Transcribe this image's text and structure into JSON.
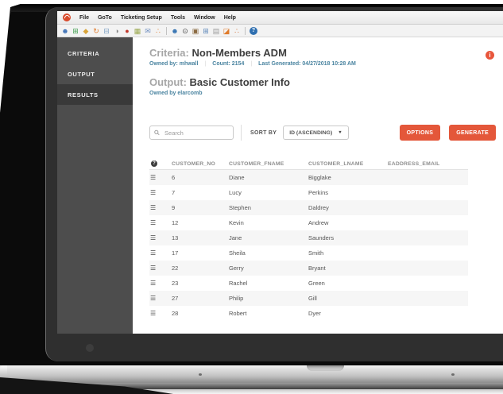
{
  "colors": {
    "accent": "#e4573a",
    "meta_text": "#4a84a0",
    "sidebar_bg": "#4d4d4d"
  },
  "menubar": {
    "items": [
      "File",
      "GoTo",
      "Ticketing Setup",
      "Tools",
      "Window",
      "Help"
    ]
  },
  "toolbar": {
    "icons": [
      {
        "name": "user-icon",
        "glyph": "☻",
        "color": "#3b6fb5"
      },
      {
        "name": "table-icon",
        "glyph": "⊞",
        "color": "#3f9e4d"
      },
      {
        "name": "diamond-icon",
        "glyph": "◆",
        "color": "#d9a43a"
      },
      {
        "name": "refresh-icon",
        "glyph": "↻",
        "color": "#e07b2a"
      },
      {
        "name": "form-icon",
        "glyph": "⊟",
        "color": "#7a9ec2"
      },
      {
        "name": "clock-icon",
        "glyph": "◑",
        "color": "#8a8a8a"
      },
      {
        "name": "record-icon",
        "glyph": "●",
        "color": "#c23b2e"
      },
      {
        "name": "grid-edit-icon",
        "glyph": "▦",
        "color": "#9aa84e"
      },
      {
        "name": "mail-icon",
        "glyph": "✉",
        "color": "#6f8fc0"
      },
      {
        "name": "share-icon",
        "glyph": "∴",
        "color": "#e07b2a"
      },
      {
        "name": "toolbar-separator",
        "glyph": "",
        "color": "#c2c2c2",
        "sep": true
      },
      {
        "name": "user-search-icon",
        "glyph": "☻",
        "color": "#2f6fb0"
      },
      {
        "name": "history-icon",
        "glyph": "⊙",
        "color": "#444444"
      },
      {
        "name": "briefcase-icon",
        "glyph": "▣",
        "color": "#8a6a42"
      },
      {
        "name": "window-icon",
        "glyph": "⊞",
        "color": "#5b86b8"
      },
      {
        "name": "printer-icon",
        "glyph": "▤",
        "color": "#9a9a9a"
      },
      {
        "name": "ticket-icon",
        "glyph": "◪",
        "color": "#e07b2a"
      },
      {
        "name": "network-icon",
        "glyph": "∴",
        "color": "#d0703a"
      },
      {
        "name": "toolbar-separator",
        "glyph": "",
        "color": "#c2c2c2",
        "sep": true
      },
      {
        "name": "help-icon",
        "glyph": "?",
        "color": "#ffffff",
        "badge": true
      }
    ]
  },
  "sidebar": {
    "items": [
      {
        "name": "sidebar-item-criteria",
        "label": "CRITERIA",
        "active": false
      },
      {
        "name": "sidebar-item-output",
        "label": "OUTPUT",
        "active": false
      },
      {
        "name": "sidebar-item-results",
        "label": "RESULTS",
        "active": true
      }
    ]
  },
  "criteria": {
    "label": "Criteria:",
    "title": "Non-Members ADM",
    "owned_by": "Owned by: mhwall",
    "count": "Count: 2154",
    "last_generated": "Last Generated: 04/27/2018 10:28 AM"
  },
  "output": {
    "label": "Output:",
    "title": "Basic Customer Info",
    "owned_by": "Owned by elarcomb"
  },
  "info_icon_glyph": "i",
  "controls": {
    "search_placeholder": "Search",
    "sort_by_label": "SORT BY",
    "sort_value": "ID (ASCENDING)",
    "caret": "▼",
    "options_label": "OPTIONS",
    "generate_label": "GENERATE"
  },
  "table": {
    "header_icon": "?",
    "row_icon": "☰",
    "columns": [
      "CUSTOMER_NO",
      "CUSTOMER_FNAME",
      "CUSTOMER_LNAME",
      "EADDRESS_EMAIL"
    ],
    "rows": [
      {
        "no": "6",
        "fname": "Diane",
        "lname": "Bigglake",
        "email": ""
      },
      {
        "no": "7",
        "fname": "Lucy",
        "lname": "Perkins",
        "email": ""
      },
      {
        "no": "9",
        "fname": "Stephen",
        "lname": "Daldrey",
        "email": ""
      },
      {
        "no": "12",
        "fname": "Kevin",
        "lname": "Andrew",
        "email": ""
      },
      {
        "no": "13",
        "fname": "Jane",
        "lname": "Saunders",
        "email": ""
      },
      {
        "no": "17",
        "fname": "Sheila",
        "lname": "Smith",
        "email": ""
      },
      {
        "no": "22",
        "fname": "Gerry",
        "lname": "Bryant",
        "email": ""
      },
      {
        "no": "23",
        "fname": "Rachel",
        "lname": "Green",
        "email": ""
      },
      {
        "no": "27",
        "fname": "Philip",
        "lname": "Gill",
        "email": ""
      },
      {
        "no": "28",
        "fname": "Robert",
        "lname": "Dyer",
        "email": ""
      }
    ]
  }
}
